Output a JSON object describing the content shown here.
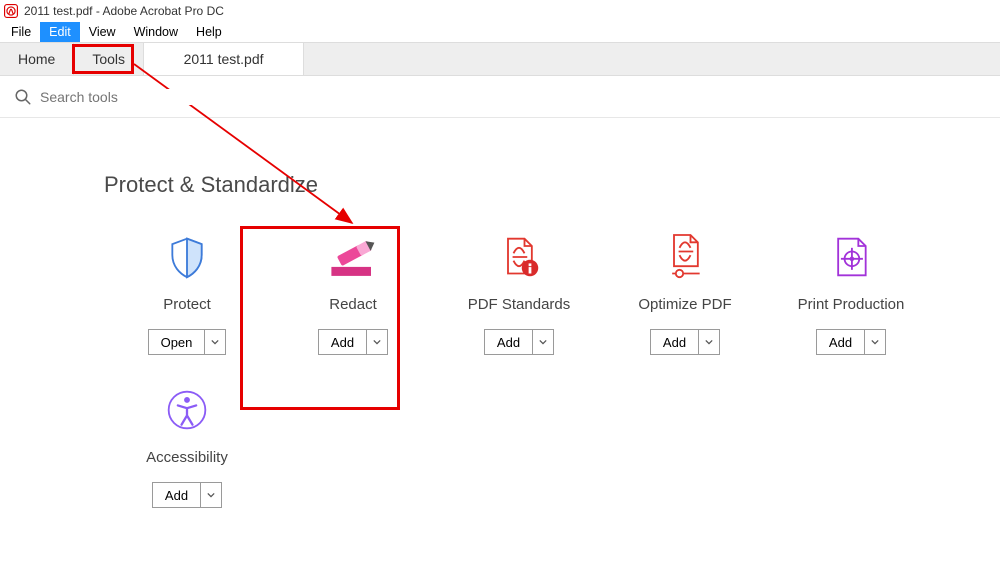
{
  "window": {
    "title": "2011 test.pdf - Adobe Acrobat Pro DC"
  },
  "menu": {
    "items": [
      "File",
      "Edit",
      "View",
      "Window",
      "Help"
    ],
    "selected_index": 1
  },
  "tabs": {
    "home_label": "Home",
    "tools_label": "Tools",
    "document_label": "2011 test.pdf"
  },
  "search": {
    "placeholder": "Search tools"
  },
  "section": {
    "title": "Protect & Standardize"
  },
  "tools": {
    "row1": [
      {
        "key": "protect",
        "label": "Protect",
        "action": "Open",
        "icon": "shield"
      },
      {
        "key": "redact",
        "label": "Redact",
        "action": "Add",
        "icon": "eraser"
      },
      {
        "key": "pdf-standards",
        "label": "PDF Standards",
        "action": "Add",
        "icon": "pdf-info"
      },
      {
        "key": "optimize-pdf",
        "label": "Optimize PDF",
        "action": "Add",
        "icon": "pdf-optimize"
      },
      {
        "key": "print-production",
        "label": "Print Production",
        "action": "Add",
        "icon": "print-target"
      }
    ],
    "row2": [
      {
        "key": "accessibility",
        "label": "Accessibility",
        "action": "Add",
        "icon": "accessibility"
      }
    ]
  },
  "colors": {
    "annotation": "#e60000",
    "menu_selected": "#1e90ff"
  }
}
